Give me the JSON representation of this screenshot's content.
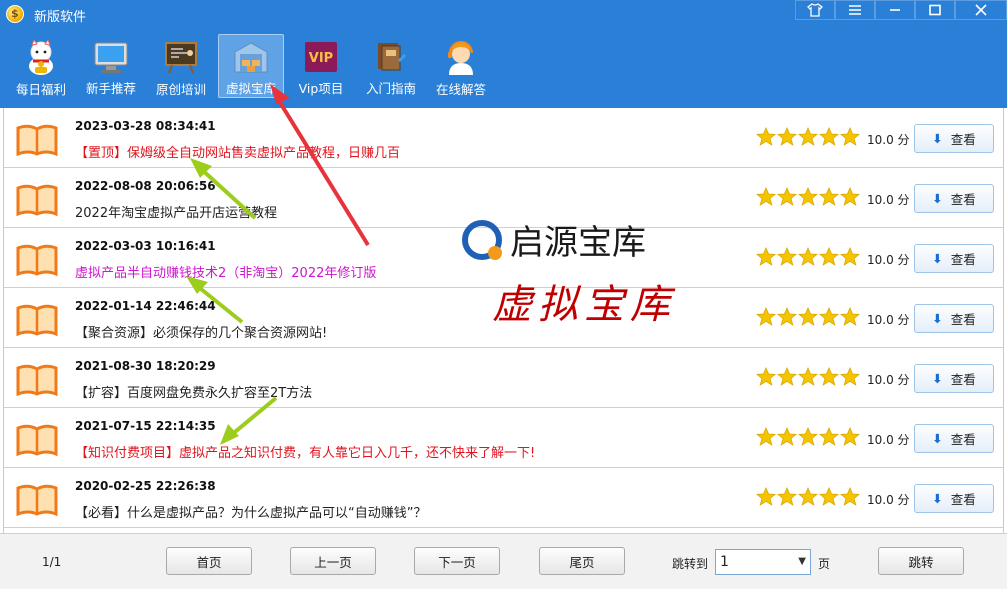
{
  "window": {
    "title": "新版软件",
    "controls": [
      "shirt-icon",
      "menu-icon",
      "minimize-icon",
      "maximize-icon",
      "close-icon"
    ]
  },
  "toolbar": {
    "items": [
      {
        "label": "每日福利",
        "icon": "lucky-cat-icon"
      },
      {
        "label": "新手推荐",
        "icon": "monitor-icon"
      },
      {
        "label": "原创培训",
        "icon": "blackboard-icon"
      },
      {
        "label": "虚拟宝库",
        "icon": "warehouse-icon",
        "active": true
      },
      {
        "label": "Vip项目",
        "icon": "vip-icon"
      },
      {
        "label": "入门指南",
        "icon": "books-icon"
      },
      {
        "label": "在线解答",
        "icon": "support-agent-icon"
      }
    ],
    "vip_badge": "VIP"
  },
  "list": {
    "items": [
      {
        "date": "2023-03-28 08:34:41",
        "title": "【置顶】保姆级全自动网站售卖虚拟产品教程，日赚几百",
        "color": "#e0141e",
        "score": "10.0 分",
        "stars": 5,
        "button": "查看"
      },
      {
        "date": "2022-08-08 20:06:56",
        "title": "2022年淘宝虚拟产品开店运营教程",
        "color": "#222222",
        "score": "10.0 分",
        "stars": 5,
        "button": "查看"
      },
      {
        "date": "2022-03-03 10:16:41",
        "title": "虚拟产品半自动赚钱技术2（非淘宝）2022年修订版",
        "color": "#d014d0",
        "score": "10.0 分",
        "stars": 5,
        "button": "查看"
      },
      {
        "date": "2022-01-14 22:46:44",
        "title": "【聚合资源】必须保存的几个聚合资源网站!",
        "color": "#222222",
        "score": "10.0 分",
        "stars": 5,
        "button": "查看"
      },
      {
        "date": "2021-08-30 18:20:29",
        "title": "【扩容】百度网盘免费永久扩容至2T方法",
        "color": "#222222",
        "score": "10.0 分",
        "stars": 5,
        "button": "查看"
      },
      {
        "date": "2021-07-15 22:14:35",
        "title": "【知识付费项目】虚拟产品之知识付费，有人靠它日入几千，还不快来了解一下!",
        "color": "#e0141e",
        "score": "10.0 分",
        "stars": 5,
        "button": "查看"
      },
      {
        "date": "2020-02-25 22:26:38",
        "title": "【必看】什么是虚拟产品？为什么虚拟产品可以“自动赚钱”？",
        "color": "#222222",
        "score": "10.0 分",
        "stars": 5,
        "button": "查看"
      }
    ]
  },
  "watermark": {
    "brand": "启源宝库",
    "caption": "虚拟宝库"
  },
  "pagination": {
    "page_info": "1/1",
    "first": "首页",
    "prev": "上一页",
    "next": "下一页",
    "last": "尾页",
    "jump_label": "跳转到",
    "jump_value": "1",
    "page_suffix": "页",
    "go": "跳转"
  },
  "colors": {
    "accent_blue": "#2a7fd6",
    "star_yellow": "#f5c400",
    "book_orange": "#f07a1a",
    "arrow_red": "#e8323c",
    "arrow_green": "#9ccc1c"
  }
}
